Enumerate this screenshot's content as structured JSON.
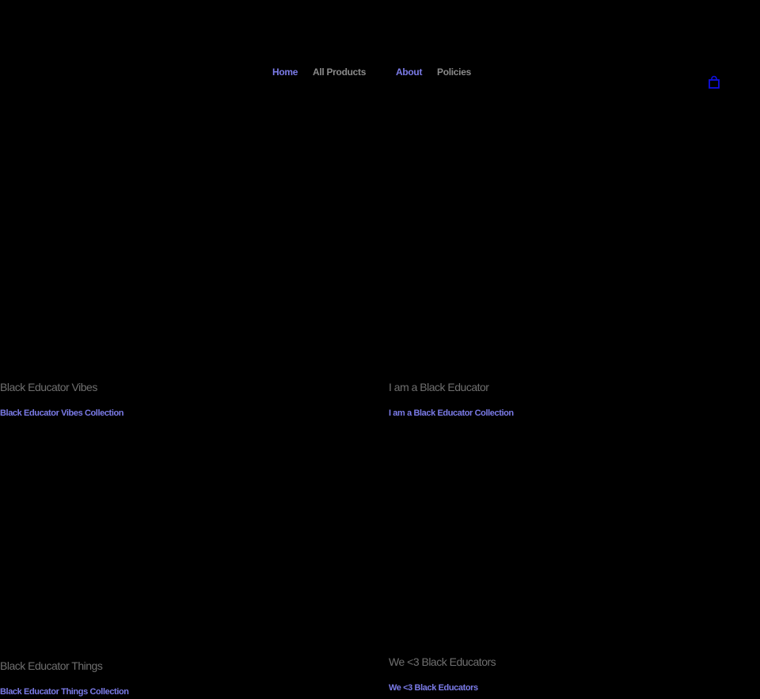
{
  "nav": {
    "items": [
      {
        "label": "Home"
      },
      {
        "label": "All Products"
      },
      {
        "label": "About"
      },
      {
        "label": "Policies"
      }
    ]
  },
  "cart": {
    "icon": "shopping-bag-icon",
    "color": "#1010e0"
  },
  "collections": [
    {
      "title": "Black Educator Vibes",
      "link": "Black Educator Vibes Collection"
    },
    {
      "title": "I am a Black Educator",
      "link": "I am a Black Educator Collection"
    },
    {
      "title": "Black Educator Things",
      "link": "Black Educator Things Collection"
    },
    {
      "title": "We <3 Black Educators",
      "link": "We <3 Black Educators"
    }
  ],
  "colors": {
    "background": "#000000",
    "link": "#7b7be8",
    "muted": "#8a8a8a",
    "title": "#6f6f6f"
  }
}
